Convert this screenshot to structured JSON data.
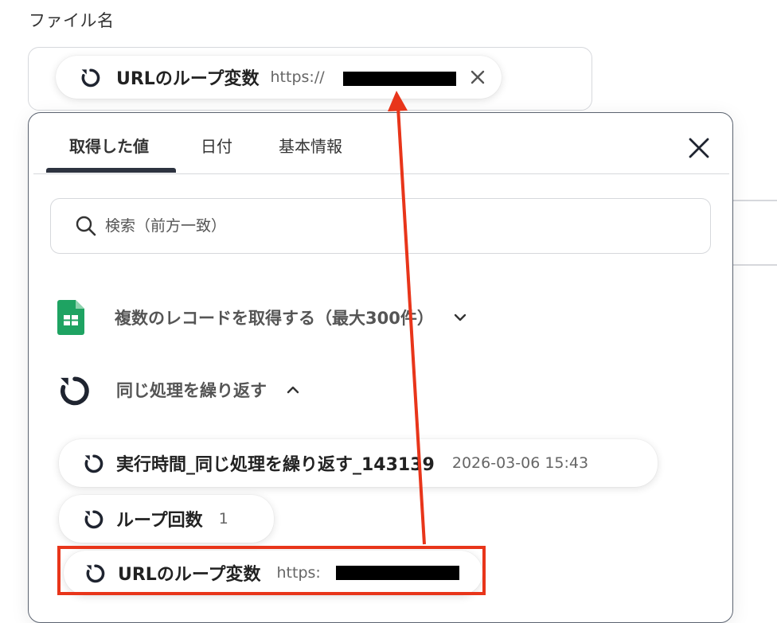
{
  "field": {
    "label": "ファイル名"
  },
  "selected_chip": {
    "label": "URLのループ変数",
    "value": "https://"
  },
  "panel": {
    "tabs": [
      {
        "label": "取得した値",
        "active": true
      },
      {
        "label": "日付",
        "active": false
      },
      {
        "label": "基本情報",
        "active": false
      }
    ],
    "search": {
      "placeholder": "検索（前方一致）"
    },
    "groups": [
      {
        "title": "複数のレコードを取得する（最大300件）",
        "expanded": false,
        "icon": "google-sheets-icon"
      },
      {
        "title": "同じ処理を繰り返す",
        "expanded": true,
        "icon": "loop-icon"
      }
    ],
    "items": [
      {
        "label": "実行時間_同じ処理を繰り返す_143139",
        "value": "2026-03-06 15:43"
      },
      {
        "label": "ループ回数",
        "value": "1"
      },
      {
        "label": "URLのループ変数",
        "value": "https:"
      }
    ]
  },
  "colors": {
    "annotation_red": "#e8351a",
    "sheets_green": "#1ea362",
    "panel_border": "#5b6370"
  }
}
